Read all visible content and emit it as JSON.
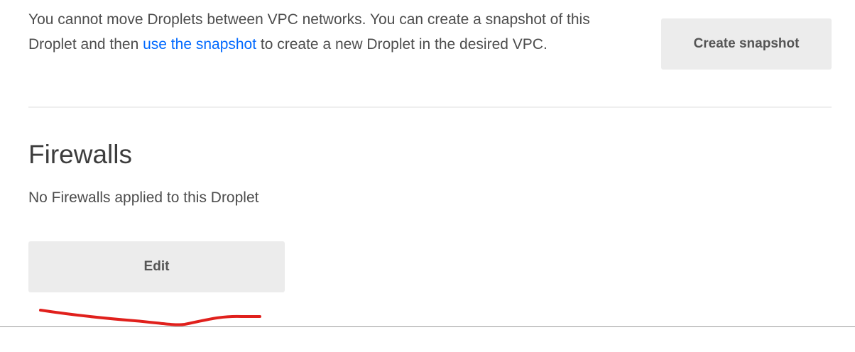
{
  "vpc": {
    "text_before": "You cannot move Droplets between VPC networks. You can create a snapshot of this Droplet and then ",
    "link_text": "use the snapshot",
    "text_after": " to create a new Droplet in the desired VPC.",
    "create_snapshot_label": "Create snapshot"
  },
  "firewalls": {
    "title": "Firewalls",
    "description": "No Firewalls applied to this Droplet",
    "edit_label": "Edit"
  },
  "colors": {
    "link": "#0069ff",
    "button_bg": "#ececec",
    "annotation": "#e0201c"
  }
}
